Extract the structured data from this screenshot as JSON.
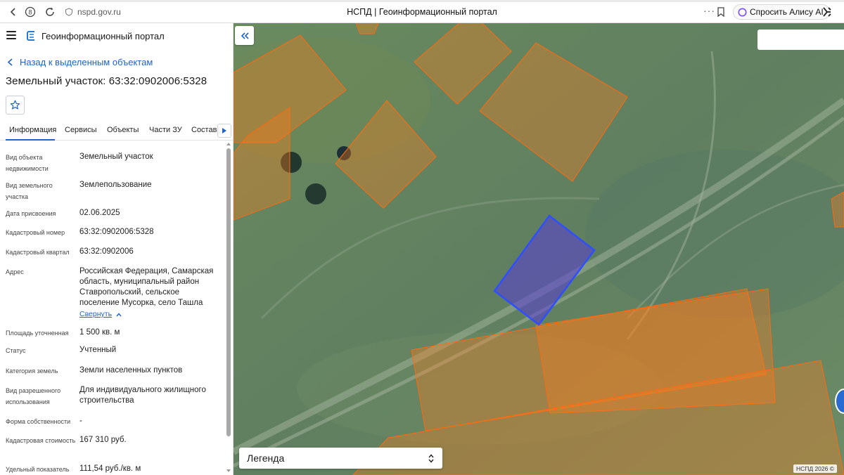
{
  "browser": {
    "url": "nspd.gov.ru",
    "tab_title": "НСПД | Геоинформационный портал",
    "alice_label": "Спросить Алису AI"
  },
  "app": {
    "title": "Геоинформационный портал"
  },
  "panel": {
    "back_label": "Назад к выделенным объектам",
    "object_title": "Земельный участок: 63:32:0902006:5328",
    "tabs": [
      {
        "label": "Информация"
      },
      {
        "label": "Сервисы"
      },
      {
        "label": "Объекты"
      },
      {
        "label": "Части ЗУ"
      },
      {
        "label": "Состав"
      }
    ],
    "fields": [
      {
        "label": "Вид объекта недвижимости",
        "value": "Земельный участок"
      },
      {
        "label": "Вид земельного участка",
        "value": "Землепользование"
      },
      {
        "label": "Дата присвоения",
        "value": "02.06.2025"
      },
      {
        "label": "Кадастровый номер",
        "value": "63:32:0902006:5328"
      },
      {
        "label": "Кадастровый квартал",
        "value": "63:32:0902006"
      },
      {
        "label": "Адрес",
        "value": "Российская Федерация, Самарская область, муниципальный район Ставропольский, сельское поселение Мусорка, село Ташла"
      },
      {
        "label": "Площадь уточненная",
        "value": "1 500 кв. м"
      },
      {
        "label": "Статус",
        "value": "Учтенный"
      },
      {
        "label": "Категория земель",
        "value": "Земли населенных пунктов"
      },
      {
        "label": "Вид разрешенного использования",
        "value": "Для индивидуального жилищного строительства"
      },
      {
        "label": "Форма собственности",
        "value": "-"
      },
      {
        "label": "Кадастровая стоимость",
        "value": "167 310 руб."
      },
      {
        "label": "Удельный показатель",
        "value": "111,54 руб./кв. м"
      }
    ],
    "collapse_label": "Свернуть"
  },
  "map": {
    "search_placeholder": "",
    "legend_label": "Легенда",
    "copyright": "НСПД 2026 ©",
    "parcel_color": "#ff7a1a",
    "selected_color": "#2f4fff"
  }
}
